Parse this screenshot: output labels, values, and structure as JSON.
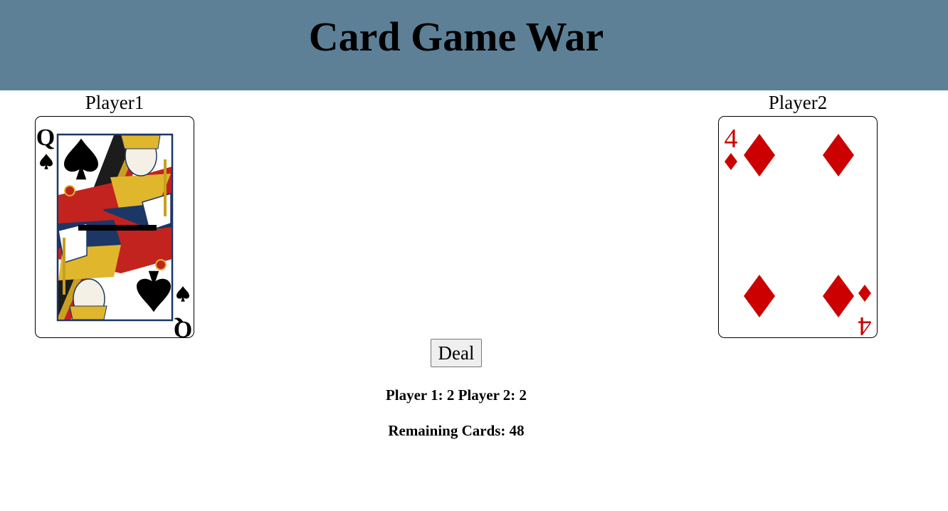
{
  "app": {
    "title": "Card Game War"
  },
  "players": [
    {
      "label": "Player1",
      "card": {
        "rank": "Q",
        "suit": "spades",
        "suit_icon": "spade-icon",
        "color": "#000000"
      }
    },
    {
      "label": "Player2",
      "card": {
        "rank": "4",
        "suit": "diamonds",
        "suit_icon": "diamond-icon",
        "color": "#cc0000"
      }
    }
  ],
  "controls": {
    "deal_label": "Deal"
  },
  "status": {
    "score_text": "Player 1: 2 Player 2: 2",
    "remaining_text": "Remaining Cards: 48"
  },
  "colors": {
    "header_bg": "#5d8097",
    "red_suit": "#cc0000",
    "black_suit": "#000000"
  }
}
